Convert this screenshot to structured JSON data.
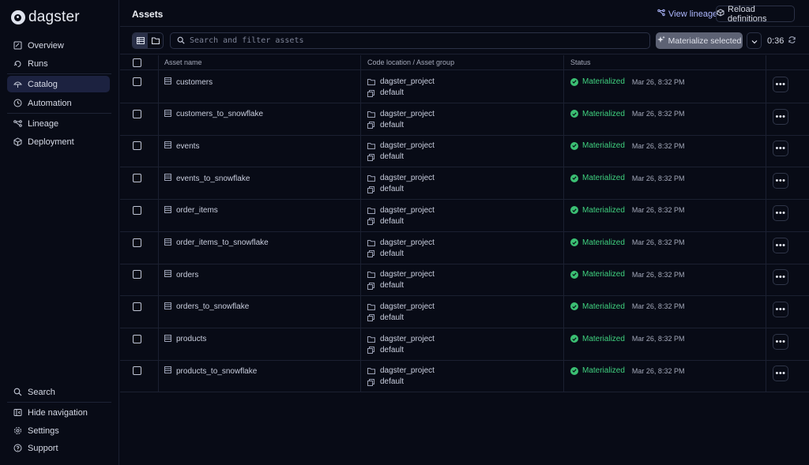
{
  "brand": {
    "name": "dagster"
  },
  "sidebar": {
    "items": [
      {
        "label": "Overview",
        "icon": "overview-icon"
      },
      {
        "label": "Runs",
        "icon": "runs-icon"
      },
      {
        "label": "Catalog",
        "icon": "catalog-icon",
        "active": true
      },
      {
        "label": "Automation",
        "icon": "clock-icon"
      },
      {
        "label": "Lineage",
        "icon": "lineage-icon"
      },
      {
        "label": "Deployment",
        "icon": "deployment-icon"
      }
    ],
    "bottom": [
      {
        "label": "Search",
        "icon": "search-icon"
      },
      {
        "label": "Hide navigation",
        "icon": "collapse-icon"
      },
      {
        "label": "Settings",
        "icon": "gear-icon"
      },
      {
        "label": "Support",
        "icon": "help-icon"
      }
    ]
  },
  "header": {
    "title": "Assets",
    "view_lineage": "View lineage",
    "reload": "Reload definitions"
  },
  "toolbar": {
    "search_placeholder": "Search and filter assets",
    "materialize_label": "Materialize selected",
    "refresh_time": "0:36"
  },
  "table": {
    "columns": [
      "Asset name",
      "Code location / Asset group",
      "Status"
    ],
    "rows": [
      {
        "name": "customers",
        "location": "dagster_project",
        "group": "default",
        "status": "Materialized",
        "time": "Mar 26, 8:32 PM"
      },
      {
        "name": "customers_to_snowflake",
        "location": "dagster_project",
        "group": "default",
        "status": "Materialized",
        "time": "Mar 26, 8:32 PM"
      },
      {
        "name": "events",
        "location": "dagster_project",
        "group": "default",
        "status": "Materialized",
        "time": "Mar 26, 8:32 PM"
      },
      {
        "name": "events_to_snowflake",
        "location": "dagster_project",
        "group": "default",
        "status": "Materialized",
        "time": "Mar 26, 8:32 PM"
      },
      {
        "name": "order_items",
        "location": "dagster_project",
        "group": "default",
        "status": "Materialized",
        "time": "Mar 26, 8:32 PM"
      },
      {
        "name": "order_items_to_snowflake",
        "location": "dagster_project",
        "group": "default",
        "status": "Materialized",
        "time": "Mar 26, 8:32 PM"
      },
      {
        "name": "orders",
        "location": "dagster_project",
        "group": "default",
        "status": "Materialized",
        "time": "Mar 26, 8:32 PM"
      },
      {
        "name": "orders_to_snowflake",
        "location": "dagster_project",
        "group": "default",
        "status": "Materialized",
        "time": "Mar 26, 8:32 PM"
      },
      {
        "name": "products",
        "location": "dagster_project",
        "group": "default",
        "status": "Materialized",
        "time": "Mar 26, 8:32 PM"
      },
      {
        "name": "products_to_snowflake",
        "location": "dagster_project",
        "group": "default",
        "status": "Materialized",
        "time": "Mar 26, 8:32 PM"
      }
    ]
  },
  "colors": {
    "background": "#080b16",
    "active_nav": "#1c2240",
    "success": "#3fd07f",
    "link": "#aeb8ff"
  }
}
